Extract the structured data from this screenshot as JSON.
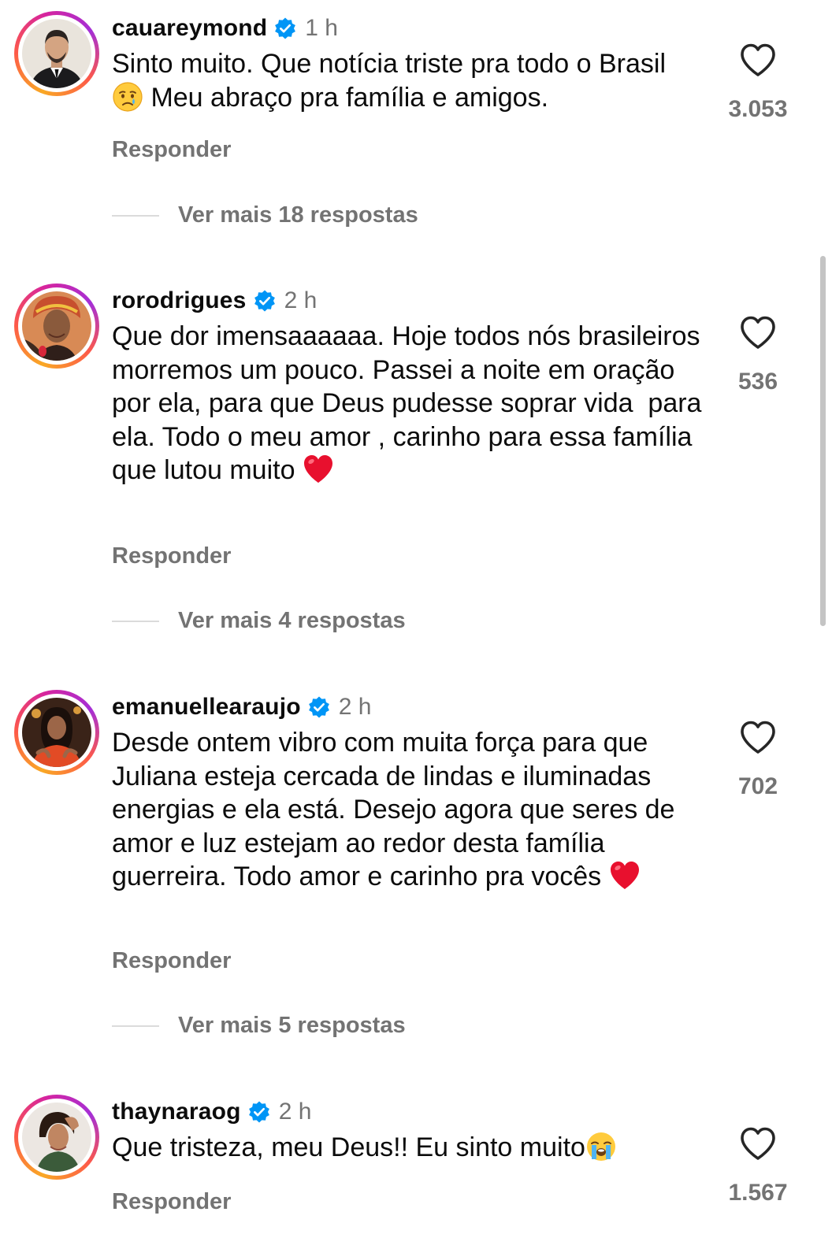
{
  "colors": {
    "text_primary": "#0c0c0c",
    "text_secondary": "#737373",
    "verified_blue": "#0095f6",
    "story_ring": [
      "#f9a825",
      "#fd5949",
      "#d6249f"
    ]
  },
  "comments": [
    {
      "username": "cauareymond",
      "verified": true,
      "time": "1 h",
      "text_before": "Sinto muito. Que notícia triste pra todo o Brasil ",
      "emoji": "crying-face",
      "text_after": " Meu abraço pra família e amigos.",
      "reply_label": "Responder",
      "more_replies": "Ver mais 18 respostas",
      "likes": "3.053",
      "avatar_icon": "avatar-man-suit"
    },
    {
      "username": "rorodrigues",
      "verified": true,
      "time": "2 h",
      "text_before": "Que dor imensaaaaaa. Hoje todos nós brasileiros morremos um pouco. Passei a noite em oração por ela, para que Deus pudesse soprar vida  para ela. Todo o meu amor , carinho para essa família que lutou muito ",
      "emoji": "red-heart",
      "text_after": "",
      "reply_label": "Responder",
      "more_replies": "Ver mais 4 respostas",
      "likes": "536",
      "avatar_icon": "avatar-woman-headscarf"
    },
    {
      "username": "emanuellearaujo",
      "verified": true,
      "time": "2 h",
      "text_before": "Desde ontem vibro com muita força para que Juliana esteja cercada de lindas e iluminadas energias e ela está. Desejo agora que seres de amor e luz estejam ao redor desta família guerreira. Todo amor e carinho pra vocês ",
      "emoji": "red-heart",
      "text_after": "",
      "reply_label": "Responder",
      "more_replies": "Ver mais 5 respostas",
      "likes": "702",
      "avatar_icon": "avatar-woman-red"
    },
    {
      "username": "thaynaraog",
      "verified": true,
      "time": "2 h",
      "text_before": "Que tristeza, meu Deus!! Eu sinto muito",
      "emoji": "loudly-crying-face",
      "text_after": "",
      "reply_label": "Responder",
      "more_replies": "",
      "likes": "1.567",
      "avatar_icon": "avatar-woman-hand-head"
    }
  ]
}
